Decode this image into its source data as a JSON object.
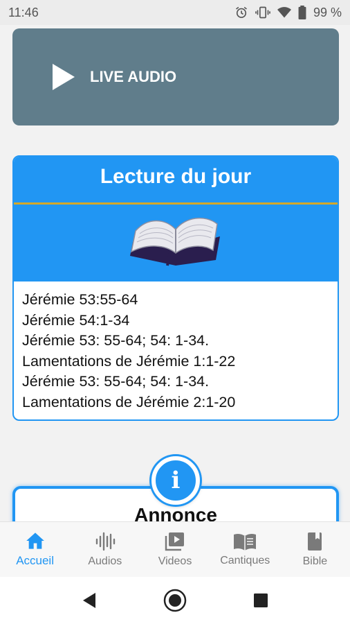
{
  "status_bar": {
    "time": "11:46",
    "battery": "99 %"
  },
  "live_audio": {
    "label": "LIVE AUDIO"
  },
  "reading": {
    "title": "Lecture du jour",
    "lines": [
      "Jérémie 53:55-64",
      "Jérémie 54:1-34",
      "Jérémie 53: 55-64; 54: 1-34.",
      "Lamentations de Jérémie 1:1-22",
      "Jérémie 53: 55-64; 54: 1-34.",
      "Lamentations de Jérémie 2:1-20"
    ]
  },
  "announcement": {
    "badge": "i",
    "title": "Annonce"
  },
  "bottom_nav": {
    "items": [
      {
        "label": "Accueil",
        "icon": "home-icon",
        "active": true
      },
      {
        "label": "Audios",
        "icon": "audio-wave-icon",
        "active": false
      },
      {
        "label": "Videos",
        "icon": "video-library-icon",
        "active": false
      },
      {
        "label": "Cantiques",
        "icon": "open-book-icon",
        "active": false
      },
      {
        "label": "Bible",
        "icon": "bible-icon",
        "active": false
      }
    ]
  },
  "colors": {
    "accent": "#2196f3",
    "live_card": "#607d8b",
    "gold": "#d4a82a",
    "inactive": "#7a7a7a"
  }
}
